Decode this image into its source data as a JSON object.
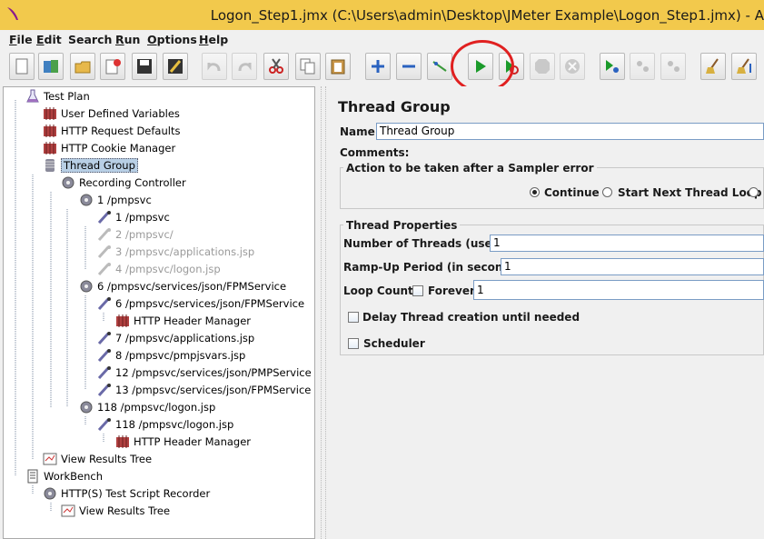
{
  "window": {
    "title": "Logon_Step1.jmx (C:\\Users\\admin\\Desktop\\JMeter Example\\Logon_Step1.jmx) - A"
  },
  "menu": [
    {
      "hotkey": "F",
      "rest": "ile"
    },
    {
      "hotkey": "E",
      "rest": "dit"
    },
    {
      "hotkey": "",
      "rest": "Search"
    },
    {
      "hotkey": "R",
      "rest": "un"
    },
    {
      "hotkey": "O",
      "rest": "ptions"
    },
    {
      "hotkey": "H",
      "rest": "elp"
    }
  ],
  "tree": {
    "nodes": [
      {
        "label": "Test Plan",
        "icon": "test-plan-icon"
      },
      {
        "label": "User Defined Variables",
        "icon": "config-element-icon"
      },
      {
        "label": "HTTP Request Defaults",
        "icon": "config-element-icon"
      },
      {
        "label": "HTTP Cookie Manager",
        "icon": "config-element-icon"
      },
      {
        "label": "Thread Group",
        "icon": "thread-group-icon"
      },
      {
        "label": "Recording Controller",
        "icon": "controller-icon"
      },
      {
        "label": "1 /pmpsvc",
        "icon": "controller-icon"
      },
      {
        "label": "1 /pmpsvc",
        "icon": "sampler-icon"
      },
      {
        "label": "2 /pmpsvc/",
        "icon": "sampler-icon"
      },
      {
        "label": "3 /pmpsvc/applications.jsp",
        "icon": "sampler-icon"
      },
      {
        "label": "4 /pmpsvc/logon.jsp",
        "icon": "sampler-icon"
      },
      {
        "label": "6 /pmpsvc/services/json/FPMService",
        "icon": "controller-icon"
      },
      {
        "label": "6 /pmpsvc/services/json/FPMService",
        "icon": "sampler-icon"
      },
      {
        "label": "HTTP Header Manager",
        "icon": "config-element-icon"
      },
      {
        "label": "7 /pmpsvc/applications.jsp",
        "icon": "sampler-icon"
      },
      {
        "label": "8 /pmpsvc/pmpjsvars.jsp",
        "icon": "sampler-icon"
      },
      {
        "label": "12 /pmpsvc/services/json/PMPService",
        "icon": "sampler-icon"
      },
      {
        "label": "13 /pmpsvc/services/json/FPMService",
        "icon": "sampler-icon"
      },
      {
        "label": "118 /pmpsvc/logon.jsp",
        "icon": "controller-icon"
      },
      {
        "label": "118 /pmpsvc/logon.jsp",
        "icon": "sampler-icon"
      },
      {
        "label": "HTTP Header Manager",
        "icon": "config-element-icon"
      },
      {
        "label": "View Results Tree",
        "icon": "listener-icon"
      },
      {
        "label": "WorkBench",
        "icon": "workbench-icon"
      },
      {
        "label": "HTTP(S) Test Script Recorder",
        "icon": "controller-icon"
      },
      {
        "label": "View Results Tree",
        "icon": "listener-icon"
      }
    ]
  },
  "panel": {
    "heading": "Thread Group",
    "name_label": "Name:",
    "name_value": "Thread Group",
    "comments_label": "Comments:",
    "sampler_error": {
      "title": "Action to be taken after a Sampler error",
      "options": [
        "Continue",
        "Start Next Thread Loop"
      ]
    },
    "thread_props": {
      "title": "Thread Properties",
      "threads_label": "Number of Threads (users):",
      "threads_value": "1",
      "rampup_label": "Ramp-Up Period (in seconds):",
      "rampup_value": "1",
      "loop_label": "Loop Count:",
      "forever_label": "Forever",
      "loop_value": "1",
      "delay_label": "Delay Thread creation until needed",
      "scheduler_label": "Scheduler"
    }
  }
}
